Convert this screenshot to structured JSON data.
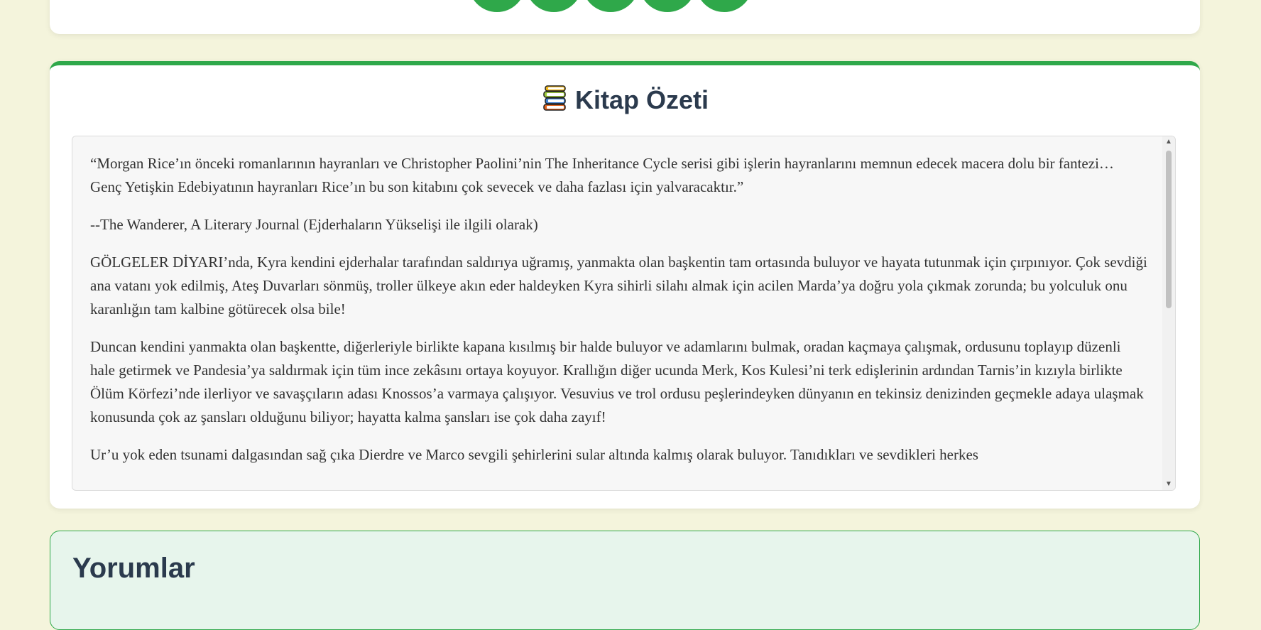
{
  "colors": {
    "background": "#f4f4dc",
    "accent_green": "#2fa84a",
    "heading": "#2b3a4d",
    "text": "#333333"
  },
  "rating": {
    "circle_count": 5,
    "icon": "rating-circle"
  },
  "summary": {
    "icon": "books-icon",
    "title": "Kitap Özeti",
    "paragraphs": [
      "“Morgan Rice’ın önceki romanlarının hayranları ve Christopher Paolini’nin The Inheritance Cycle serisi gibi işlerin hayranlarını memnun edecek macera dolu bir fantezi… Genç Yetişkin Edebiyatının hayranları Rice’ın bu son kitabını çok sevecek ve daha fazlası için yalvaracaktır.”",
      "--The Wanderer, A Literary Journal (Ejderhaların Yükselişi ile ilgili olarak)",
      "GÖLGELER DİYARI’nda, Kyra kendini ejderhalar tarafından saldırıya uğramış, yanmakta olan başkentin tam ortasında buluyor ve hayata tutunmak için çırpınıyor. Çok sevdiği ana vatanı yok edilmiş, Ateş Duvarları sönmüş, troller ülkeye akın eder haldeyken Kyra sihirli silahı almak için acilen Marda’ya doğru yola çıkmak zorunda; bu yolculuk onu karanlığın tam kalbine götürecek olsa bile!",
      "Duncan kendini yanmakta olan başkentte, diğerleriyle birlikte kapana kısılmış bir halde buluyor ve adamlarını bulmak, oradan kaçmaya çalışmak, ordusunu toplayıp düzenli hale getirmek ve Pandesia’ya saldırmak için tüm ince zekâsını ortaya koyuyor. Krallığın diğer ucunda Merk, Kos Kulesi’ni terk edişlerinin ardından Tarnis’in kızıyla birlikte Ölüm Körfezi’nde ilerliyor ve savaşçıların adası Knossos’a varmaya çalışıyor. Vesuvius ve trol ordusu peşlerindeyken dünyanın en tekinsiz denizinden geçmekle adaya ulaşmak konusunda çok az şansları olduğunu biliyor; hayatta kalma şansları ise çok daha zayıf!",
      "Ur’u yok eden tsunami dalgasından sağ çıka Dierdre ve Marco sevgili şehirlerini sular altında kalmış olarak buluyor. Tanıdıkları ve sevdikleri herkes"
    ]
  },
  "comments": {
    "title": "Yorumlar"
  }
}
